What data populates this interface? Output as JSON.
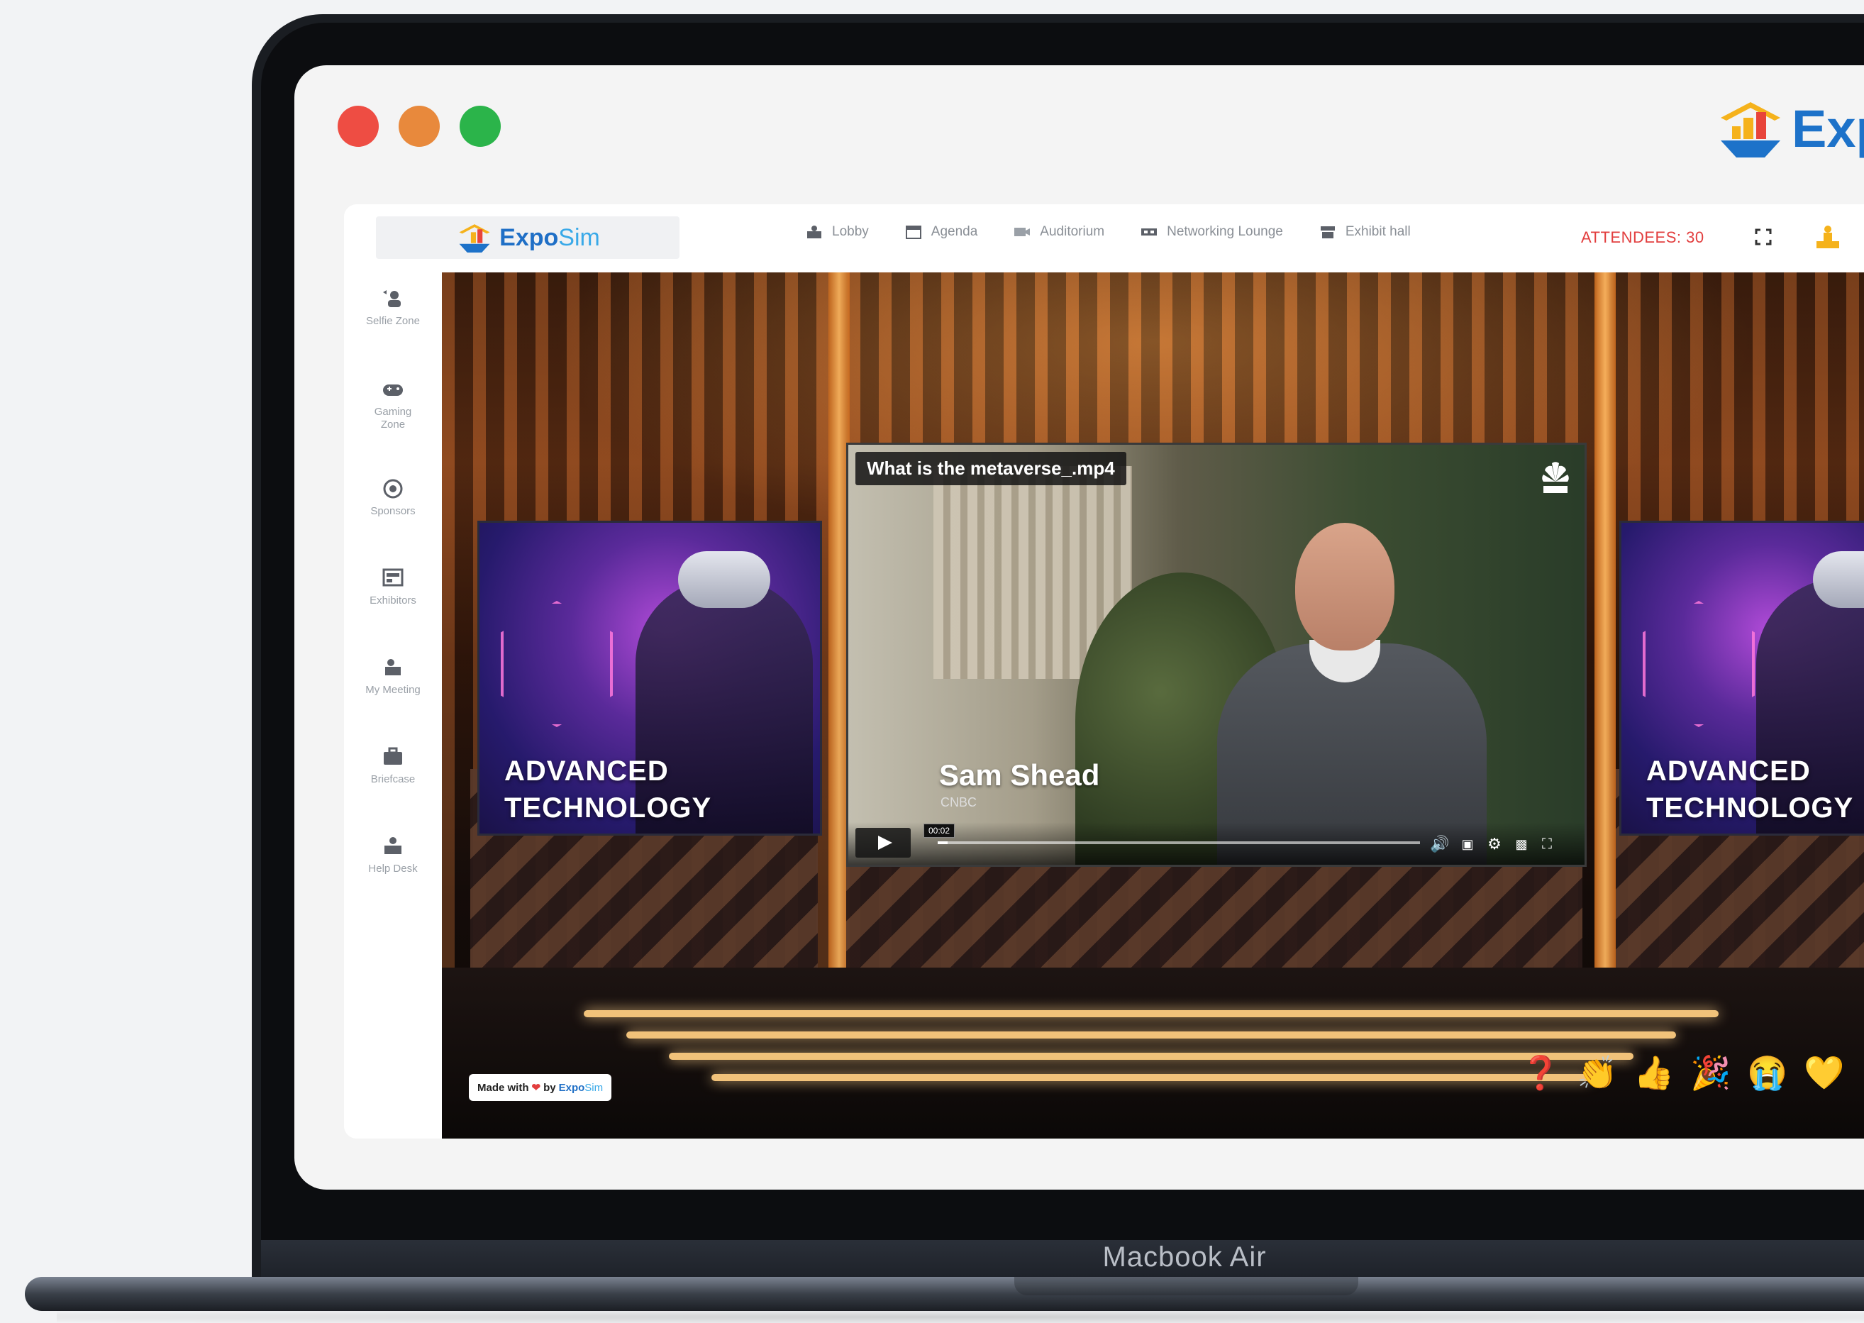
{
  "device": {
    "label": "Macbook Air"
  },
  "window": {
    "traffic_lights": [
      "close",
      "minimize",
      "maximize"
    ]
  },
  "top_logo": {
    "text": "Exp"
  },
  "app": {
    "brand": {
      "part1": "Expo",
      "part2": "Sim"
    },
    "nav": [
      {
        "label": "Lobby",
        "icon": "lobby-icon"
      },
      {
        "label": "Agenda",
        "icon": "calendar-icon"
      },
      {
        "label": "Auditorium",
        "icon": "auditorium-icon"
      },
      {
        "label": "Networking Lounge",
        "icon": "networking-icon"
      },
      {
        "label": "Exhibit hall",
        "icon": "exhibit-hall-icon"
      }
    ],
    "attendees": "ATTENDEES: 30",
    "sidebar": [
      {
        "label": "Selfie Zone",
        "icon": "selfie-icon"
      },
      {
        "label": "Gaming Zone",
        "icon": "gamepad-icon"
      },
      {
        "label": "Sponsors",
        "icon": "sponsors-icon"
      },
      {
        "label": "Exhibitors",
        "icon": "exhibitors-icon"
      },
      {
        "label": "My Meeting",
        "icon": "meeting-icon"
      },
      {
        "label": "Briefcase",
        "icon": "briefcase-icon"
      },
      {
        "label": "Help Desk",
        "icon": "help-desk-icon"
      }
    ]
  },
  "stage": {
    "side_screen_text_line1": "ADVANCED",
    "side_screen_text_line2": "TECHNOLOGY",
    "video": {
      "title": "What is the metaverse_.mp4",
      "speaker_name": "Sam Shead",
      "speaker_org": "CNBC",
      "time": "00:02",
      "progress": 0.02
    },
    "badge": {
      "made_with": "Made with",
      "by": "by",
      "brand1": "Expo",
      "brand2": "Sim"
    },
    "reactions": [
      "question",
      "clap",
      "thumbs-up",
      "party",
      "sad",
      "heart"
    ]
  },
  "colors": {
    "accent": "#1f6fc6",
    "attendees": "#e23e3e"
  }
}
